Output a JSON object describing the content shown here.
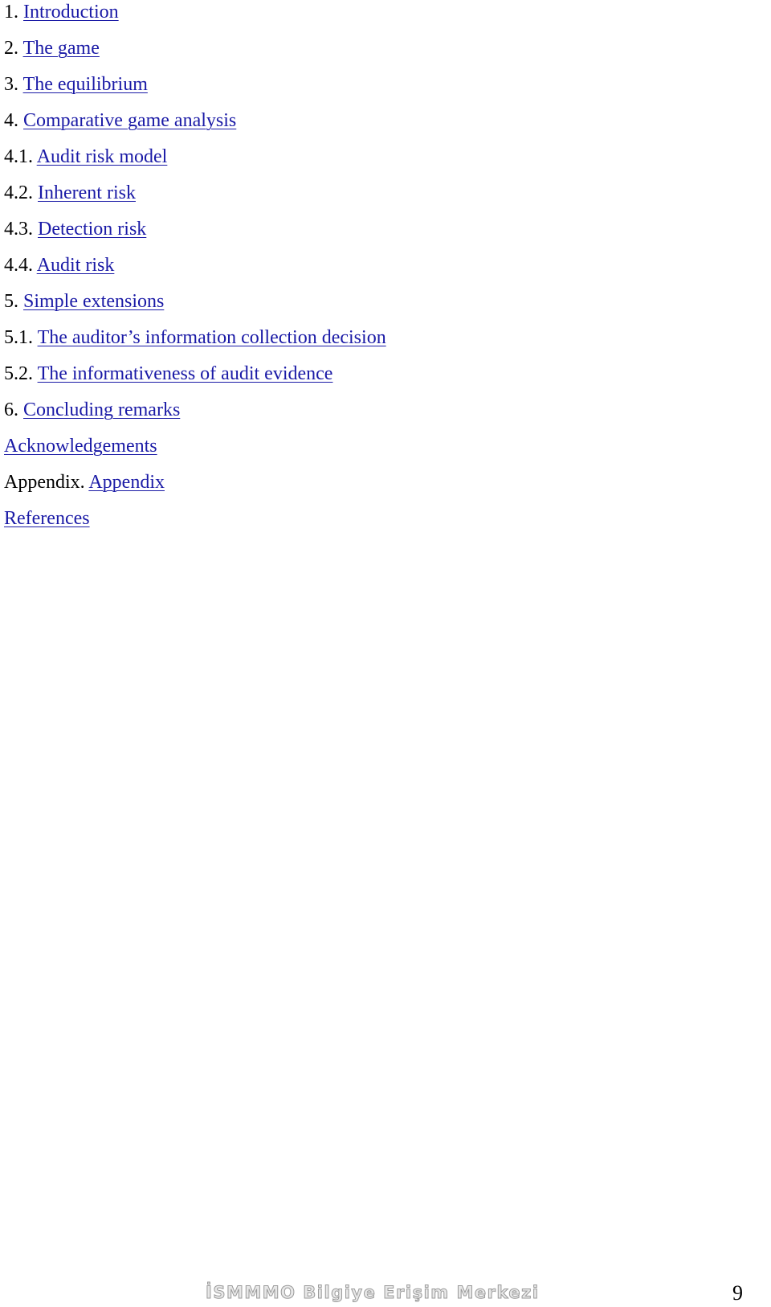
{
  "toc": [
    {
      "prefix": "1. ",
      "link": "Introduction"
    },
    {
      "prefix": "2. ",
      "link": "The game"
    },
    {
      "prefix": "3. ",
      "link": "The equilibrium"
    },
    {
      "prefix": "4. ",
      "link": "Comparative game analysis"
    },
    {
      "prefix": "4.1. ",
      "link": "Audit risk model"
    },
    {
      "prefix": "4.2. ",
      "link": "Inherent risk"
    },
    {
      "prefix": "4.3. ",
      "link": "Detection risk"
    },
    {
      "prefix": "4.4. ",
      "link": "Audit risk"
    },
    {
      "prefix": "5. ",
      "link": "Simple extensions"
    },
    {
      "prefix": "5.1. ",
      "link": "The auditor’s information collection decision"
    },
    {
      "prefix": "5.2. ",
      "link": "The informativeness of audit evidence"
    },
    {
      "prefix": "6. ",
      "link": "Concluding remarks"
    },
    {
      "prefix": "",
      "link": "Acknowledgements"
    },
    {
      "prefix": "Appendix. ",
      "link": "Appendix"
    },
    {
      "prefix": "",
      "link": "References"
    }
  ],
  "footer": {
    "brand": "İSMMMO Bilgiye Erişim Merkezi",
    "page_number": "9"
  },
  "colors": {
    "link": "#1a1aa6",
    "text": "#000000"
  }
}
